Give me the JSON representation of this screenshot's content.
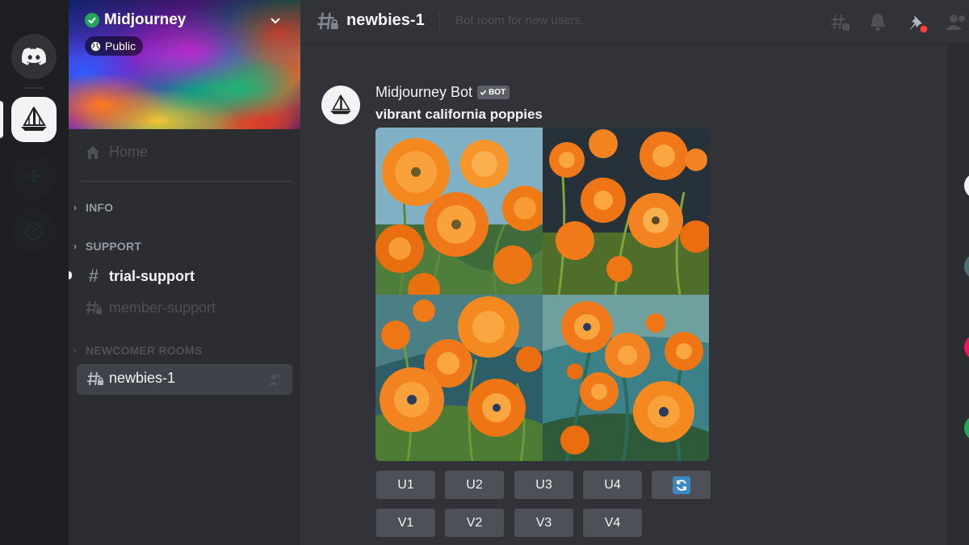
{
  "server": {
    "name": "Midjourney",
    "visibility": "Public"
  },
  "sidebar": {
    "home_label": "Home",
    "categories": [
      {
        "label": "INFO"
      },
      {
        "label": "SUPPORT"
      },
      {
        "label": "NEWCOMER ROOMS"
      }
    ],
    "channels": [
      {
        "label": "trial-support",
        "category": "SUPPORT",
        "state": "unread"
      },
      {
        "label": "member-support",
        "category": "SUPPORT",
        "state": "locked"
      },
      {
        "label": "newbies-1",
        "category": "NEWCOMER ROOMS",
        "state": "active"
      }
    ]
  },
  "header": {
    "channel": "newbies-1",
    "topic": "Bot room for new users."
  },
  "message": {
    "author": "Midjourney Bot",
    "tag": "BOT",
    "prompt": "vibrant california poppies"
  },
  "buttons": {
    "upscale": [
      "U1",
      "U2",
      "U3",
      "U4"
    ],
    "variation": [
      "V1",
      "V2",
      "V3",
      "V4"
    ],
    "reroll_icon": "refresh-icon"
  },
  "colors": {
    "background": "#313338",
    "sidebar": "#2b2d31",
    "rail": "#1e1f22",
    "button": "#4e5058",
    "poppy_orange": "#f47a16",
    "verified_green": "#23a55a"
  }
}
